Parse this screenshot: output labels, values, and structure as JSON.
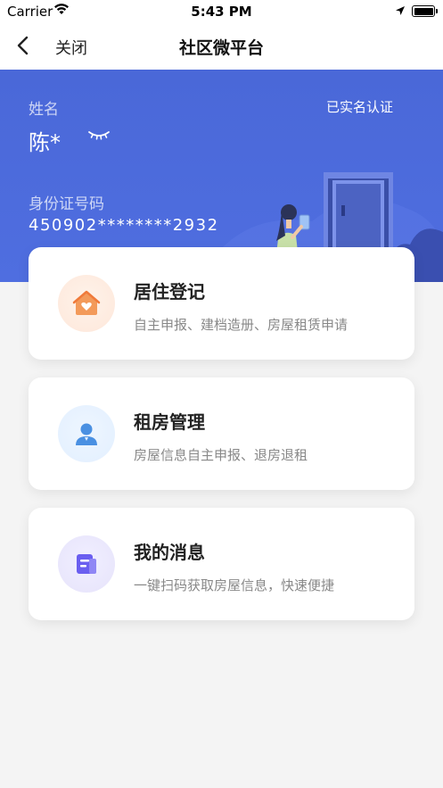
{
  "status_bar": {
    "carrier": "Carrier",
    "time": "5:43 PM"
  },
  "nav": {
    "close_label": "关闭",
    "title": "社区微平台"
  },
  "profile": {
    "name_label": "姓名",
    "name_value": "陈*",
    "verified_text": "已实名认证",
    "id_label": "身份证号码",
    "id_value": "450902********2932"
  },
  "cards": [
    {
      "title": "居住登记",
      "desc": "自主申报、建档造册、房屋租赁申请",
      "icon": "house-heart-icon"
    },
    {
      "title": "租房管理",
      "desc": "房屋信息自主申报、退房退租",
      "icon": "person-icon"
    },
    {
      "title": "我的消息",
      "desc": "一键扫码获取房屋信息，快速便捷",
      "icon": "message-icon"
    }
  ],
  "colors": {
    "banner": "#4f6ee0",
    "card_bg": "#ffffff",
    "page_bg": "#f4f4f4"
  }
}
